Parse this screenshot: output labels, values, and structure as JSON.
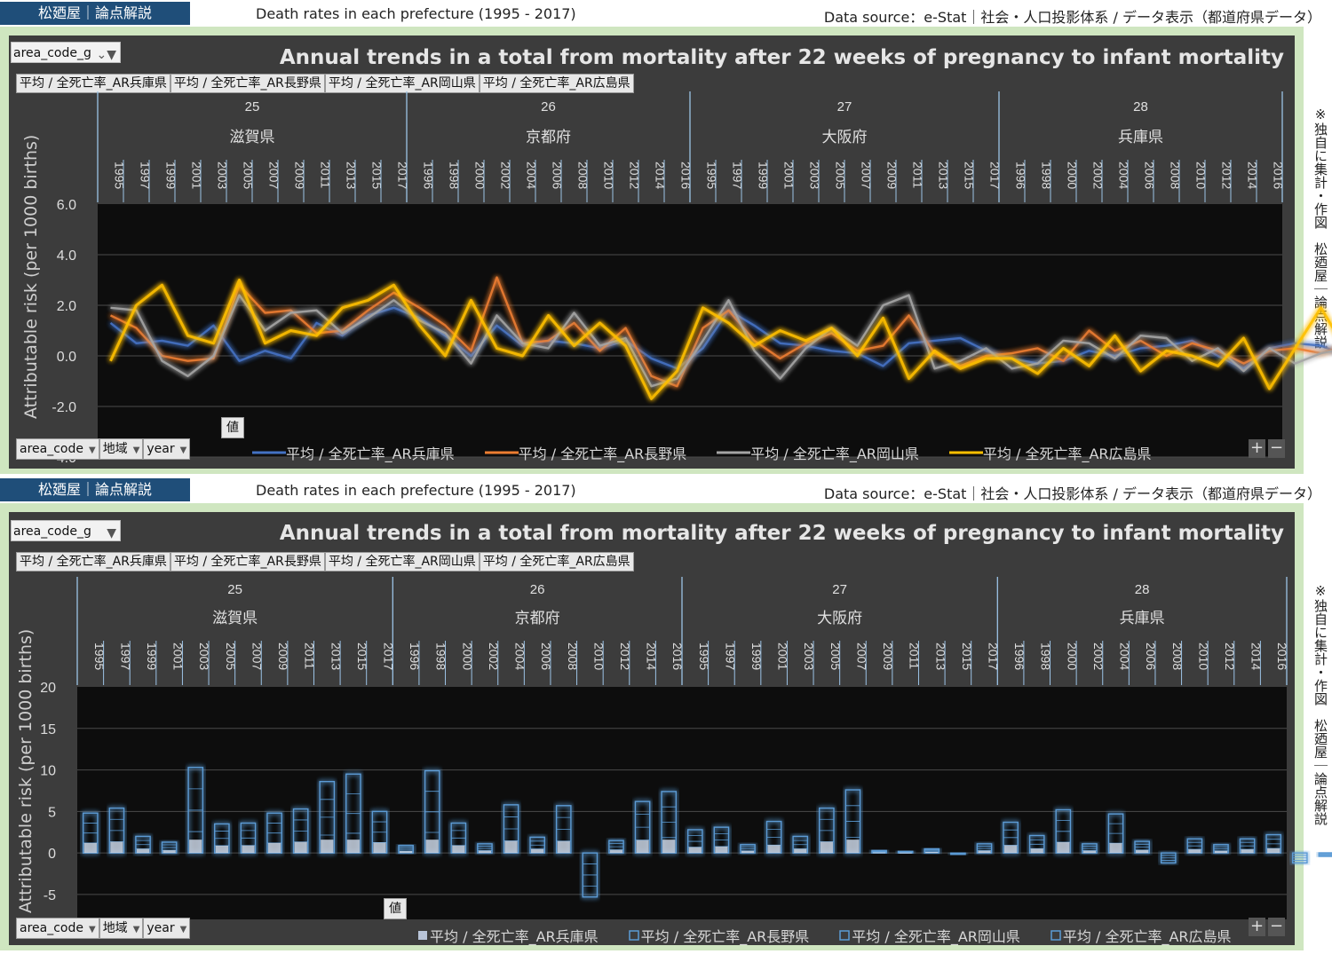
{
  "header": {
    "brand": "松廼屋｜論点解説",
    "subtitle": "Death rates in each prefecture (1995 - 2017)",
    "source": "Data source：e-Stat｜社会・人口投影体系 / データ表示（都道府県データ）"
  },
  "side_note": "※独自に集計・作図　松廼屋｜論点解説",
  "filter": {
    "label": "area_code_g"
  },
  "legend_tabs": [
    "平均 / 全死亡率_AR兵庫県",
    "平均 / 全死亡率_AR長野県",
    "平均 / 全死亡率_AR岡山県",
    "平均 / 全死亡率_AR広島県"
  ],
  "value_button": "値",
  "bottom_buttons": [
    "area_code",
    "地域",
    "year"
  ],
  "colors": {
    "hyogo": "#4472c4",
    "nagano": "#ed7d31",
    "okayama": "#a5a5a5",
    "hiroshima": "#ffc000",
    "bar": "#5b9bd5"
  },
  "chart_data": [
    {
      "type": "line",
      "title": "Annual trends in a total from mortality after 22 weeks of pregnancy to infant mortality",
      "ylabel": "Attributable risk (per 1000 births)",
      "ylim": [
        -4,
        6
      ],
      "yticks": [
        "6.0",
        "4.0",
        "2.0",
        "0.0",
        "-2.0",
        "-4.0"
      ],
      "groups": [
        {
          "code": "25",
          "name": "滋賀県",
          "years": [
            "1995",
            "1997",
            "1999",
            "2001",
            "2003",
            "2005",
            "2007",
            "2009",
            "2011",
            "2013",
            "2015",
            "2017"
          ]
        },
        {
          "code": "26",
          "name": "京都府",
          "years": [
            "1996",
            "1998",
            "2000",
            "2002",
            "2004",
            "2006",
            "2008",
            "2010",
            "2012",
            "2014",
            "2016"
          ]
        },
        {
          "code": "27",
          "name": "大阪府",
          "years": [
            "1995",
            "1997",
            "1999",
            "2001",
            "2003",
            "2005",
            "2007",
            "2009",
            "2011",
            "2013",
            "2015",
            "2017"
          ]
        },
        {
          "code": "28",
          "name": "兵庫県",
          "years": [
            "1996",
            "1998",
            "2000",
            "2002",
            "2004",
            "2006",
            "2008",
            "2010",
            "2012",
            "2014",
            "2016"
          ]
        }
      ],
      "series": [
        {
          "name": "平均 / 全死亡率_AR兵庫県",
          "values": [
            1.3,
            0.5,
            0.6,
            0.4,
            1.2,
            -0.2,
            0.2,
            -0.1,
            1.3,
            0.8,
            1.6,
            1.9,
            1.5,
            0.8,
            0.0,
            1.2,
            0.4,
            0.6,
            0.5,
            0.3,
            0.6,
            -0.1,
            -0.5,
            0.3,
            1.8,
            1.2,
            0.5,
            0.4,
            0.2,
            0.1,
            -0.4,
            0.5,
            0.6,
            0.7,
            0.2,
            -0.1,
            -0.3,
            -0.2,
            0.2,
            0.0,
            0.3,
            0.4,
            0.6,
            0.0,
            -0.5,
            0.3,
            0.5,
            0.4,
            0.0,
            -0.3,
            0.5,
            0.2,
            -0.1,
            0.4,
            0.3,
            0.0,
            -0.4,
            0.2,
            -0.2,
            -0.3,
            0.5,
            0.3,
            0.0,
            0.2,
            0.3,
            0.2,
            0.0,
            0.2,
            0.1,
            0.6,
            0.4,
            0.2,
            0.3,
            0.2,
            0.1,
            0.0,
            0.0,
            0.0,
            0.0,
            0.0,
            0.0,
            0.0,
            0.0,
            0.0,
            0.0,
            0.0,
            0.0,
            0.0,
            0.0,
            0.0,
            0.0
          ]
        },
        {
          "name": "平均 / 全死亡率_AR長野県",
          "values": [
            1.6,
            1.1,
            0.0,
            -0.2,
            -0.1,
            2.8,
            1.7,
            1.8,
            0.9,
            1.0,
            1.8,
            2.5,
            1.9,
            1.2,
            0.2,
            3.1,
            0.5,
            0.6,
            1.3,
            0.2,
            1.1,
            -0.8,
            -1.2,
            1.1,
            1.8,
            0.6,
            -0.1,
            0.5,
            0.9,
            0.2,
            0.4,
            1.6,
            0.1,
            -0.4,
            0.0,
            0.1,
            0.3,
            -0.2,
            1.0,
            0.2,
            0.6,
            0.0,
            0.5,
            0.2,
            -0.3,
            0.2,
            0.3,
            0.1,
            0.4,
            -0.7,
            0.2,
            0.4,
            0.2,
            0.8,
            0.3,
            0.4,
            0.9,
            0.3,
            0.7,
            1.0,
            1.2,
            0.7,
            0.5,
            0.2,
            0.3,
            0.1,
            0.3,
            0.9,
            0.2,
            0.6,
            -0.7,
            -0.5,
            0.5,
            1.9,
            0.3,
            -0.2,
            0.0,
            0.6,
            0.5,
            0.2,
            0.0,
            0.4,
            -0.2,
            0.4,
            1.0,
            0.2,
            0.0,
            -0.3,
            0.8,
            0.8,
            -0.7,
            -0.2
          ]
        },
        {
          "name": "平均 / 全死亡率_AR岡山県",
          "values": [
            1.9,
            1.8,
            -0.2,
            -0.8,
            0.0,
            2.4,
            1.0,
            1.7,
            1.8,
            0.9,
            1.5,
            2.2,
            1.4,
            0.9,
            -0.3,
            1.6,
            0.5,
            0.3,
            1.7,
            0.4,
            0.7,
            -1.2,
            -0.9,
            0.6,
            2.2,
            0.2,
            -0.9,
            0.3,
            1.1,
            0.4,
            2.0,
            2.4,
            -0.5,
            -0.2,
            0.3,
            -0.5,
            -0.3,
            0.6,
            0.5,
            -0.1,
            0.8,
            0.7,
            -0.2,
            0.3,
            -0.6,
            0.3,
            -0.3,
            0.1,
            0.3,
            0.1,
            -0.3,
            0.8,
            -0.3,
            0.8,
            0.2,
            0.6,
            0.3,
            0.1,
            0.1,
            -0.2,
            0.3,
            0.6,
            0.0,
            0.2,
            0.0,
            0.2,
            -0.2,
            0.5,
            -0.4,
            0.1,
            0.7,
            -1.3,
            0.3,
            0.3,
            -1.5,
            0.4,
            -0.1,
            0.7,
            0.3,
            0.6,
            0.1,
            0.0,
            -0.2,
            0.5,
            0.1,
            -0.3,
            -0.4,
            -0.6,
            0.4,
            -0.3,
            0.5,
            -1.2,
            -1.0
          ]
        },
        {
          "name": "平均 / 全死亡率_AR広島県",
          "values": [
            -0.2,
            2.0,
            2.8,
            0.8,
            0.5,
            3.0,
            0.5,
            1.0,
            0.8,
            1.9,
            2.2,
            2.8,
            1.2,
            0.0,
            2.2,
            0.3,
            0.0,
            1.6,
            0.4,
            1.3,
            0.4,
            -1.7,
            -0.6,
            1.9,
            1.3,
            0.4,
            1.0,
            0.6,
            1.1,
            0.0,
            1.5,
            -0.9,
            0.2,
            -0.5,
            -0.1,
            -0.1,
            -0.7,
            0.3,
            -0.4,
            0.8,
            -0.6,
            0.2,
            0.0,
            -0.4,
            0.7,
            -1.3,
            0.3,
            1.9,
            0.2,
            -0.5,
            1.3,
            0.0,
            0.8,
            -0.3,
            0.4,
            0.3,
            0.6,
            1.0,
            -0.2,
            -0.2,
            -0.1,
            0.5,
            0.5,
            0.4,
            -0.3,
            -0.3,
            0.2,
            -0.5,
            -0.3,
            0.5,
            -1.0,
            1.4,
            2.2,
            -0.4,
            0.9,
            0.8,
            -0.2,
            1.4,
            -0.5,
            0.3,
            -0.5,
            1.1,
            -0.2,
            -0.3,
            -0.2,
            -0.1,
            -0.4,
            0.2,
            -0.2,
            0.6,
            -1.2,
            -1.0
          ]
        }
      ]
    },
    {
      "type": "bar",
      "title": "Annual trends in a total from mortality after 22 weeks of pregnancy to infant mortality",
      "ylabel": "Attributable risk (per 1000 births)",
      "ylim": [
        -8,
        20
      ],
      "yticks": [
        "20",
        "15",
        "10",
        "5",
        "0",
        "-5"
      ],
      "groups": [
        {
          "code": "25",
          "name": "滋賀県",
          "years": [
            "1995",
            "1997",
            "1999",
            "2001",
            "2003",
            "2005",
            "2007",
            "2009",
            "2011",
            "2013",
            "2015",
            "2017"
          ]
        },
        {
          "code": "26",
          "name": "京都府",
          "years": [
            "1996",
            "1998",
            "2000",
            "2002",
            "2004",
            "2006",
            "2008",
            "2010",
            "2012",
            "2014",
            "2016"
          ]
        },
        {
          "code": "27",
          "name": "大阪府",
          "years": [
            "1995",
            "1997",
            "1999",
            "2001",
            "2003",
            "2005",
            "2007",
            "2009",
            "2011",
            "2013",
            "2015",
            "2017"
          ]
        },
        {
          "code": "28",
          "name": "兵庫県",
          "years": [
            "1996",
            "1998",
            "2000",
            "2002",
            "2004",
            "2006",
            "2008",
            "2010",
            "2012",
            "2014",
            "2016"
          ]
        }
      ],
      "series": [
        {
          "name": "平均 / 全死亡率_AR兵庫県",
          "style": "solid"
        },
        {
          "name": "平均 / 全死亡率_AR長野県",
          "style": "outline"
        },
        {
          "name": "平均 / 全死亡率_AR岡山県",
          "style": "outline"
        },
        {
          "name": "平均 / 全死亡率_AR広島県",
          "style": "outline"
        }
      ],
      "stack_totals": [
        4.8,
        5.4,
        2.0,
        1.3,
        10.3,
        3.5,
        3.6,
        4.8,
        5.3,
        8.6,
        9.5,
        5.0,
        0.9,
        9.9,
        3.6,
        1.1,
        5.8,
        1.9,
        5.7,
        -5.3,
        1.5,
        6.2,
        7.4,
        2.8,
        3.1,
        1.0,
        3.8,
        2.0,
        5.4,
        7.6,
        0.3,
        0.2,
        0.5,
        -0.2,
        1.1,
        3.7,
        2.1,
        5.2,
        1.1,
        4.7,
        1.4,
        -1.2,
        1.7,
        1.0,
        1.7,
        2.2,
        -1.2,
        -0.4,
        2.7,
        1.2,
        2.2,
        2.1,
        1.6,
        3.5,
        0.8,
        2.1,
        1.6,
        1.9,
        3.2,
        2.4,
        1.4,
        1.0,
        -0.7,
        2.0,
        1.0,
        1.0,
        1.1,
        3.8,
        1.4,
        1.7,
        -2.3,
        -1.2,
        2.8,
        3.0,
        2.8,
        1.3,
        3.5,
        1.4,
        1.2,
        -0.6,
        2.9,
        0.7,
        1.7,
        2.4,
        1.6,
        0.6,
        -0.9,
        2.2,
        1.1,
        -2.6,
        -1.8
      ]
    }
  ]
}
